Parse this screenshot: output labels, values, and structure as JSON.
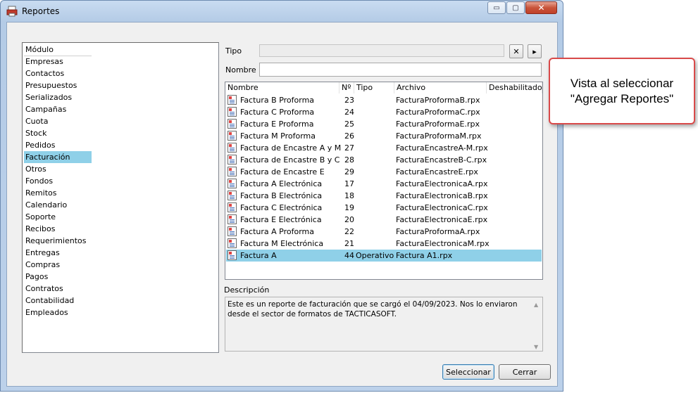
{
  "window": {
    "title": "Reportes",
    "controls": {
      "minimize": "▭",
      "maximize": "▢",
      "close": "✕"
    }
  },
  "modules": {
    "header": "Módulo",
    "items": [
      "Empresas",
      "Contactos",
      "Presupuestos",
      "Serializados",
      "Campañas",
      "Cuota",
      "Stock",
      "Pedidos",
      "Facturación",
      "Otros",
      "Fondos",
      "Remitos",
      "Calendario",
      "Soporte",
      "Recibos",
      "Requerimientos",
      "Entregas",
      "Compras",
      "Pagos",
      "Contratos",
      "Contabilidad",
      "Empleados"
    ],
    "selected": "Facturación"
  },
  "form": {
    "tipo_label": "Tipo",
    "tipo_value": "",
    "clear_icon": "✕",
    "next_icon": "▸",
    "nombre_label": "Nombre",
    "nombre_value": ""
  },
  "reports": {
    "columns": [
      "Nombre",
      "Nº",
      "Tipo",
      "Archivo",
      "Deshabilitado"
    ],
    "rows": [
      {
        "nombre": "Factura B Proforma",
        "num": "23",
        "tipo": "",
        "archivo": "FacturaProformaB.rpx",
        "deshabilitado": ""
      },
      {
        "nombre": "Factura C Proforma",
        "num": "24",
        "tipo": "",
        "archivo": "FacturaProformaC.rpx",
        "deshabilitado": ""
      },
      {
        "nombre": "Factura E Proforma",
        "num": "25",
        "tipo": "",
        "archivo": "FacturaProformaE.rpx",
        "deshabilitado": ""
      },
      {
        "nombre": "Factura M Proforma",
        "num": "26",
        "tipo": "",
        "archivo": "FacturaProformaM.rpx",
        "deshabilitado": ""
      },
      {
        "nombre": "Factura de Encastre A y M",
        "num": "27",
        "tipo": "",
        "archivo": "FacturaEncastreA-M.rpx",
        "deshabilitado": ""
      },
      {
        "nombre": "Factura de Encastre B y C",
        "num": "28",
        "tipo": "",
        "archivo": "FacturaEncastreB-C.rpx",
        "deshabilitado": ""
      },
      {
        "nombre": "Factura de Encastre E",
        "num": "29",
        "tipo": "",
        "archivo": "FacturaEncastreE.rpx",
        "deshabilitado": ""
      },
      {
        "nombre": "Factura A Electrónica",
        "num": "17",
        "tipo": "",
        "archivo": "FacturaElectronicaA.rpx",
        "deshabilitado": ""
      },
      {
        "nombre": "Factura B Electrónica",
        "num": "18",
        "tipo": "",
        "archivo": "FacturaElectronicaB.rpx",
        "deshabilitado": ""
      },
      {
        "nombre": "Factura C Electrónica",
        "num": "19",
        "tipo": "",
        "archivo": "FacturaElectronicaC.rpx",
        "deshabilitado": ""
      },
      {
        "nombre": "Factura E Electrónica",
        "num": "20",
        "tipo": "",
        "archivo": "FacturaElectronicaE.rpx",
        "deshabilitado": ""
      },
      {
        "nombre": "Factura A Proforma",
        "num": "22",
        "tipo": "",
        "archivo": "FacturaProformaA.rpx",
        "deshabilitado": ""
      },
      {
        "nombre": "Factura M Electrónica",
        "num": "21",
        "tipo": "",
        "archivo": "FacturaElectronicaM.rpx",
        "deshabilitado": ""
      },
      {
        "nombre": "Factura A",
        "num": "44",
        "tipo": "Operativo",
        "archivo": "Factura A1.rpx",
        "deshabilitado": ""
      }
    ],
    "selected_index": 13
  },
  "description": {
    "label": "Descripción",
    "text": "Este es un reporte de facturación que se cargó el 04/09/2023. Nos lo enviaron desde el sector de formatos de TACTICASOFT.",
    "scroll_up": "▲",
    "scroll_down": "▼"
  },
  "buttons": {
    "select": "Seleccionar",
    "close": "Cerrar"
  },
  "callout": {
    "text": "Vista al seleccionar \"Agregar Reportes\""
  },
  "colors": {
    "selection": "#8fd0e8",
    "callout_border": "#d94a4a"
  }
}
